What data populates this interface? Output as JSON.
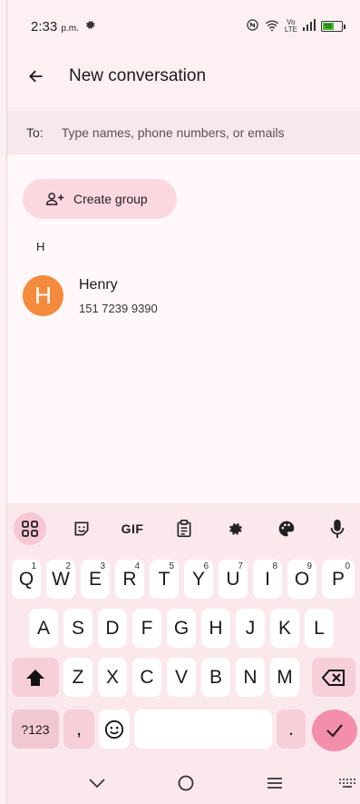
{
  "status_bar": {
    "time": "2:33",
    "ampm": "p.m.",
    "battery_text": "59"
  },
  "app_bar": {
    "title": "New conversation"
  },
  "to_field": {
    "label": "To:",
    "placeholder": "Type names, phone numbers, or emails",
    "value": ""
  },
  "content": {
    "create_group_label": "Create group",
    "section_letter": "H",
    "contacts": [
      {
        "initial": "H",
        "name": "Henry",
        "phone": "151 7239 9390",
        "avatar_color": "#f38a3c"
      }
    ]
  },
  "keyboard": {
    "toolbar": [
      "apps-grid-icon",
      "sticker-icon",
      "GIF",
      "clipboard-icon",
      "settings-icon",
      "palette-icon",
      "microphone-icon"
    ],
    "gif_label": "GIF",
    "row1": [
      {
        "k": "Q",
        "s": "1"
      },
      {
        "k": "W",
        "s": "2"
      },
      {
        "k": "E",
        "s": "3"
      },
      {
        "k": "R",
        "s": "4"
      },
      {
        "k": "T",
        "s": "5"
      },
      {
        "k": "Y",
        "s": "6"
      },
      {
        "k": "U",
        "s": "7"
      },
      {
        "k": "I",
        "s": "8"
      },
      {
        "k": "O",
        "s": "9"
      },
      {
        "k": "P",
        "s": "0"
      }
    ],
    "row2": [
      "A",
      "S",
      "D",
      "F",
      "G",
      "H",
      "J",
      "K",
      "L"
    ],
    "row3": [
      "Z",
      "X",
      "C",
      "V",
      "B",
      "N",
      "M"
    ],
    "symbols_label": "?123",
    "comma_label": ",",
    "period_label": ".",
    "accent_color": "#f48fab"
  }
}
